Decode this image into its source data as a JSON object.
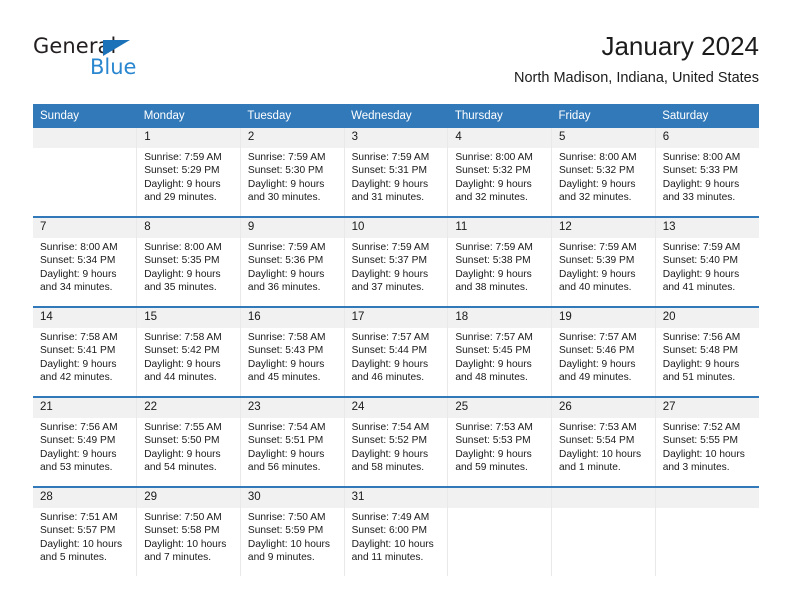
{
  "brand": {
    "name_dark": "General",
    "name_blue": "Blue",
    "accent_blue": "#2a87cf",
    "triangle_blue": "#1b72b8"
  },
  "header": {
    "title": "January 2024",
    "location": "North Madison, Indiana, United States"
  },
  "theme": {
    "header_bar": "#3279b9",
    "daynum_band": "#f1f1f1",
    "week_separator": "#3279b9",
    "text": "#1a1a1a"
  },
  "calendar": {
    "weekday_headers": [
      "Sunday",
      "Monday",
      "Tuesday",
      "Wednesday",
      "Thursday",
      "Friday",
      "Saturday"
    ],
    "weeks": [
      [
        {
          "day": "",
          "lines": []
        },
        {
          "day": "1",
          "lines": [
            "Sunrise: 7:59 AM",
            "Sunset: 5:29 PM",
            "Daylight: 9 hours",
            "and 29 minutes."
          ]
        },
        {
          "day": "2",
          "lines": [
            "Sunrise: 7:59 AM",
            "Sunset: 5:30 PM",
            "Daylight: 9 hours",
            "and 30 minutes."
          ]
        },
        {
          "day": "3",
          "lines": [
            "Sunrise: 7:59 AM",
            "Sunset: 5:31 PM",
            "Daylight: 9 hours",
            "and 31 minutes."
          ]
        },
        {
          "day": "4",
          "lines": [
            "Sunrise: 8:00 AM",
            "Sunset: 5:32 PM",
            "Daylight: 9 hours",
            "and 32 minutes."
          ]
        },
        {
          "day": "5",
          "lines": [
            "Sunrise: 8:00 AM",
            "Sunset: 5:32 PM",
            "Daylight: 9 hours",
            "and 32 minutes."
          ]
        },
        {
          "day": "6",
          "lines": [
            "Sunrise: 8:00 AM",
            "Sunset: 5:33 PM",
            "Daylight: 9 hours",
            "and 33 minutes."
          ]
        }
      ],
      [
        {
          "day": "7",
          "lines": [
            "Sunrise: 8:00 AM",
            "Sunset: 5:34 PM",
            "Daylight: 9 hours",
            "and 34 minutes."
          ]
        },
        {
          "day": "8",
          "lines": [
            "Sunrise: 8:00 AM",
            "Sunset: 5:35 PM",
            "Daylight: 9 hours",
            "and 35 minutes."
          ]
        },
        {
          "day": "9",
          "lines": [
            "Sunrise: 7:59 AM",
            "Sunset: 5:36 PM",
            "Daylight: 9 hours",
            "and 36 minutes."
          ]
        },
        {
          "day": "10",
          "lines": [
            "Sunrise: 7:59 AM",
            "Sunset: 5:37 PM",
            "Daylight: 9 hours",
            "and 37 minutes."
          ]
        },
        {
          "day": "11",
          "lines": [
            "Sunrise: 7:59 AM",
            "Sunset: 5:38 PM",
            "Daylight: 9 hours",
            "and 38 minutes."
          ]
        },
        {
          "day": "12",
          "lines": [
            "Sunrise: 7:59 AM",
            "Sunset: 5:39 PM",
            "Daylight: 9 hours",
            "and 40 minutes."
          ]
        },
        {
          "day": "13",
          "lines": [
            "Sunrise: 7:59 AM",
            "Sunset: 5:40 PM",
            "Daylight: 9 hours",
            "and 41 minutes."
          ]
        }
      ],
      [
        {
          "day": "14",
          "lines": [
            "Sunrise: 7:58 AM",
            "Sunset: 5:41 PM",
            "Daylight: 9 hours",
            "and 42 minutes."
          ]
        },
        {
          "day": "15",
          "lines": [
            "Sunrise: 7:58 AM",
            "Sunset: 5:42 PM",
            "Daylight: 9 hours",
            "and 44 minutes."
          ]
        },
        {
          "day": "16",
          "lines": [
            "Sunrise: 7:58 AM",
            "Sunset: 5:43 PM",
            "Daylight: 9 hours",
            "and 45 minutes."
          ]
        },
        {
          "day": "17",
          "lines": [
            "Sunrise: 7:57 AM",
            "Sunset: 5:44 PM",
            "Daylight: 9 hours",
            "and 46 minutes."
          ]
        },
        {
          "day": "18",
          "lines": [
            "Sunrise: 7:57 AM",
            "Sunset: 5:45 PM",
            "Daylight: 9 hours",
            "and 48 minutes."
          ]
        },
        {
          "day": "19",
          "lines": [
            "Sunrise: 7:57 AM",
            "Sunset: 5:46 PM",
            "Daylight: 9 hours",
            "and 49 minutes."
          ]
        },
        {
          "day": "20",
          "lines": [
            "Sunrise: 7:56 AM",
            "Sunset: 5:48 PM",
            "Daylight: 9 hours",
            "and 51 minutes."
          ]
        }
      ],
      [
        {
          "day": "21",
          "lines": [
            "Sunrise: 7:56 AM",
            "Sunset: 5:49 PM",
            "Daylight: 9 hours",
            "and 53 minutes."
          ]
        },
        {
          "day": "22",
          "lines": [
            "Sunrise: 7:55 AM",
            "Sunset: 5:50 PM",
            "Daylight: 9 hours",
            "and 54 minutes."
          ]
        },
        {
          "day": "23",
          "lines": [
            "Sunrise: 7:54 AM",
            "Sunset: 5:51 PM",
            "Daylight: 9 hours",
            "and 56 minutes."
          ]
        },
        {
          "day": "24",
          "lines": [
            "Sunrise: 7:54 AM",
            "Sunset: 5:52 PM",
            "Daylight: 9 hours",
            "and 58 minutes."
          ]
        },
        {
          "day": "25",
          "lines": [
            "Sunrise: 7:53 AM",
            "Sunset: 5:53 PM",
            "Daylight: 9 hours",
            "and 59 minutes."
          ]
        },
        {
          "day": "26",
          "lines": [
            "Sunrise: 7:53 AM",
            "Sunset: 5:54 PM",
            "Daylight: 10 hours",
            "and 1 minute."
          ]
        },
        {
          "day": "27",
          "lines": [
            "Sunrise: 7:52 AM",
            "Sunset: 5:55 PM",
            "Daylight: 10 hours",
            "and 3 minutes."
          ]
        }
      ],
      [
        {
          "day": "28",
          "lines": [
            "Sunrise: 7:51 AM",
            "Sunset: 5:57 PM",
            "Daylight: 10 hours",
            "and 5 minutes."
          ]
        },
        {
          "day": "29",
          "lines": [
            "Sunrise: 7:50 AM",
            "Sunset: 5:58 PM",
            "Daylight: 10 hours",
            "and 7 minutes."
          ]
        },
        {
          "day": "30",
          "lines": [
            "Sunrise: 7:50 AM",
            "Sunset: 5:59 PM",
            "Daylight: 10 hours",
            "and 9 minutes."
          ]
        },
        {
          "day": "31",
          "lines": [
            "Sunrise: 7:49 AM",
            "Sunset: 6:00 PM",
            "Daylight: 10 hours",
            "and 11 minutes."
          ]
        },
        {
          "day": "",
          "lines": []
        },
        {
          "day": "",
          "lines": []
        },
        {
          "day": "",
          "lines": []
        }
      ]
    ]
  }
}
